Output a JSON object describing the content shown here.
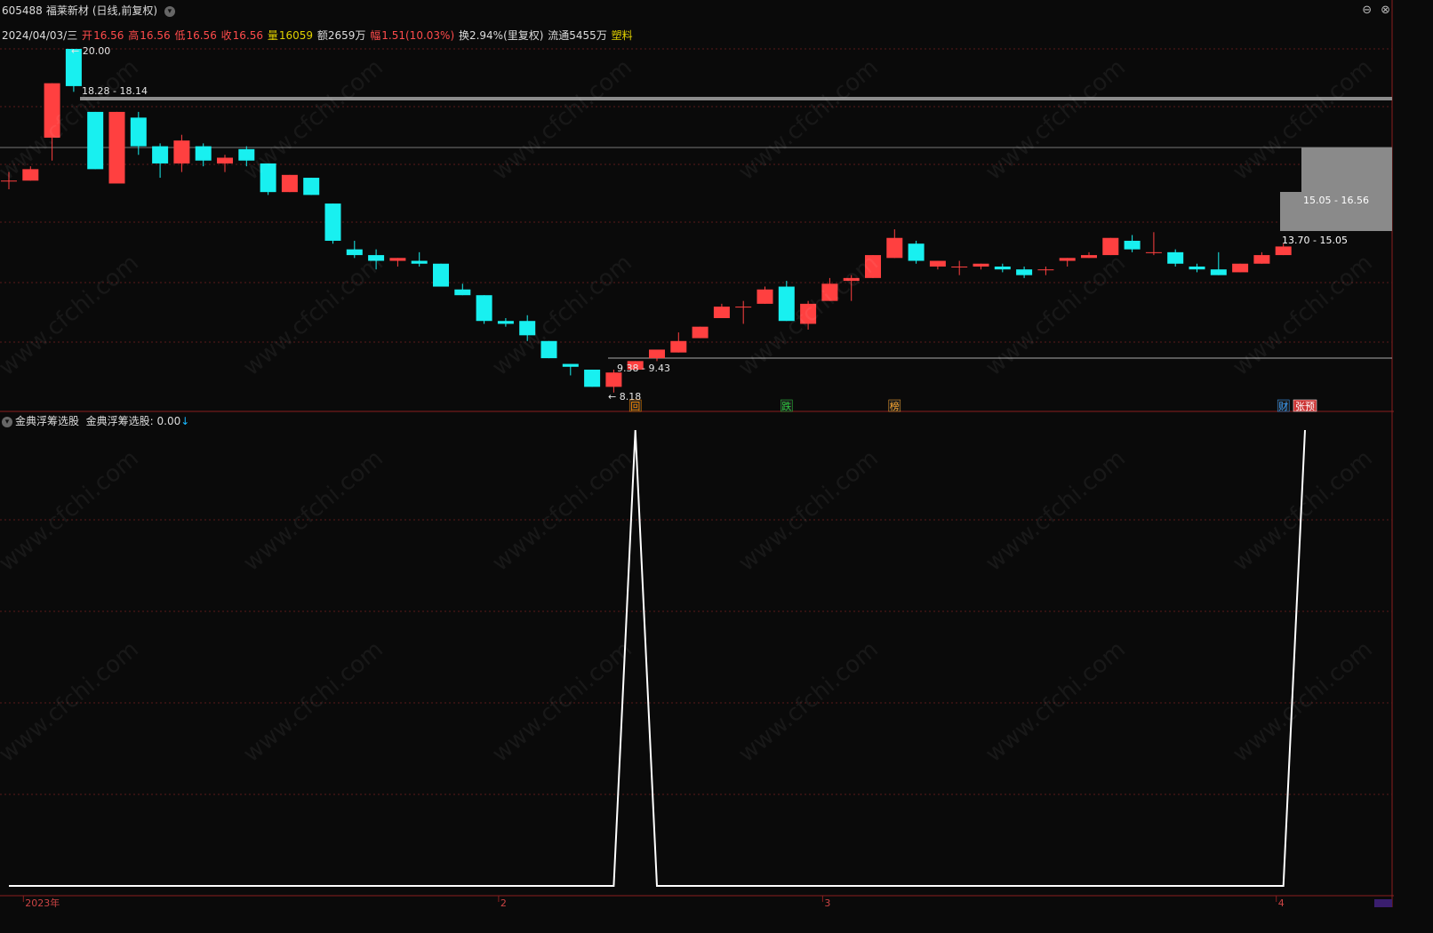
{
  "header": {
    "code": "605488",
    "name": "福莱新材",
    "period": "(日线,前复权)",
    "collapse_icon": "chevron-down-icon",
    "window_controls": [
      "⊖",
      "⊗"
    ]
  },
  "info": {
    "date": "2024/04/03/三",
    "open_label": "开",
    "open": "16.56",
    "high_label": "高",
    "high": "16.56",
    "low_label": "低",
    "low": "16.56",
    "close_label": "收",
    "close": "16.56",
    "vol_label": "量",
    "vol": "16059",
    "amount": "额2659万",
    "change_label": "幅",
    "change": "1.51(10.03%)",
    "turnover": "换2.94%(里复权)",
    "float": "流通5455万",
    "sector": "塑料"
  },
  "indicator": {
    "name": "金典浮筹选股",
    "value_label": "金典浮筹选股: 0.00",
    "arrow": "↓"
  },
  "chart_data": {
    "type": "candlestick",
    "x_labels": [
      {
        "idx": 1,
        "text": "2023年"
      },
      {
        "idx": 23,
        "text": "2"
      },
      {
        "idx": 38,
        "text": "3"
      },
      {
        "idx": 59,
        "text": "4"
      }
    ],
    "annotations": {
      "high": "20.00",
      "low": "8.18",
      "zone_top": "18.28 - 18.14",
      "zone_low": "9.38 - 9.43",
      "zone_right1": "15.05 - 16.56",
      "zone_right2": "13.70 - 15.05"
    },
    "markers": [
      {
        "idx": 29,
        "text": "回",
        "color": "#ff8a00",
        "bg": "#222"
      },
      {
        "idx": 36,
        "text": "跌",
        "color": "#2ecc40",
        "bg": "#1a1a1a"
      },
      {
        "idx": 41,
        "text": "榜",
        "color": "#ffaa33",
        "bg": "#1a1a1a"
      },
      {
        "idx": 59,
        "text": "财",
        "color": "#3fa3ff",
        "bg": "#1a1a1a"
      },
      {
        "idx": 60,
        "text": "张预",
        "color": "#ffffff",
        "bg": "#cc3333"
      }
    ],
    "candles": [
      {
        "o": 15.4,
        "h": 15.7,
        "l": 15.1,
        "c": 15.4
      },
      {
        "o": 15.4,
        "h": 15.9,
        "l": 15.4,
        "c": 15.8
      },
      {
        "o": 16.9,
        "h": 18.8,
        "l": 16.1,
        "c": 18.8
      },
      {
        "o": 20.0,
        "h": 20.0,
        "l": 18.5,
        "c": 18.7
      },
      {
        "o": 17.8,
        "h": 17.8,
        "l": 15.8,
        "c": 15.8
      },
      {
        "o": 15.3,
        "h": 17.8,
        "l": 15.3,
        "c": 17.8
      },
      {
        "o": 17.6,
        "h": 17.8,
        "l": 16.3,
        "c": 16.6
      },
      {
        "o": 16.6,
        "h": 16.7,
        "l": 15.5,
        "c": 16.0
      },
      {
        "o": 16.0,
        "h": 17.0,
        "l": 15.7,
        "c": 16.8
      },
      {
        "o": 16.6,
        "h": 16.7,
        "l": 15.9,
        "c": 16.1
      },
      {
        "o": 16.0,
        "h": 16.3,
        "l": 15.7,
        "c": 16.2
      },
      {
        "o": 16.5,
        "h": 16.6,
        "l": 15.9,
        "c": 16.1
      },
      {
        "o": 16.0,
        "h": 16.0,
        "l": 14.9,
        "c": 15.0
      },
      {
        "o": 15.0,
        "h": 15.6,
        "l": 15.0,
        "c": 15.6
      },
      {
        "o": 15.5,
        "h": 15.5,
        "l": 14.9,
        "c": 14.9
      },
      {
        "o": 14.6,
        "h": 14.6,
        "l": 13.2,
        "c": 13.3
      },
      {
        "o": 13.0,
        "h": 13.3,
        "l": 12.7,
        "c": 12.8
      },
      {
        "o": 12.8,
        "h": 13.0,
        "l": 12.3,
        "c": 12.6
      },
      {
        "o": 12.6,
        "h": 12.7,
        "l": 12.4,
        "c": 12.7
      },
      {
        "o": 12.6,
        "h": 12.9,
        "l": 12.4,
        "c": 12.5
      },
      {
        "o": 12.5,
        "h": 12.5,
        "l": 11.7,
        "c": 11.7
      },
      {
        "o": 11.6,
        "h": 11.8,
        "l": 11.4,
        "c": 11.4
      },
      {
        "o": 11.4,
        "h": 11.4,
        "l": 10.4,
        "c": 10.5
      },
      {
        "o": 10.5,
        "h": 10.6,
        "l": 10.3,
        "c": 10.4
      },
      {
        "o": 10.5,
        "h": 10.7,
        "l": 9.8,
        "c": 10.0
      },
      {
        "o": 9.8,
        "h": 9.8,
        "l": 9.2,
        "c": 9.2
      },
      {
        "o": 9.0,
        "h": 9.0,
        "l": 8.6,
        "c": 8.9
      },
      {
        "o": 8.8,
        "h": 8.8,
        "l": 8.2,
        "c": 8.2
      },
      {
        "o": 8.2,
        "h": 8.8,
        "l": 8.0,
        "c": 8.7
      },
      {
        "o": 8.8,
        "h": 9.1,
        "l": 8.8,
        "c": 9.1
      },
      {
        "o": 9.2,
        "h": 9.5,
        "l": 9.1,
        "c": 9.5
      },
      {
        "o": 9.4,
        "h": 10.1,
        "l": 9.4,
        "c": 9.8
      },
      {
        "o": 9.9,
        "h": 10.3,
        "l": 9.9,
        "c": 10.3
      },
      {
        "o": 10.6,
        "h": 11.1,
        "l": 10.6,
        "c": 11.0
      },
      {
        "o": 11.0,
        "h": 11.2,
        "l": 10.4,
        "c": 11.0
      },
      {
        "o": 11.1,
        "h": 11.7,
        "l": 11.1,
        "c": 11.6
      },
      {
        "o": 11.7,
        "h": 11.9,
        "l": 10.5,
        "c": 10.5
      },
      {
        "o": 10.4,
        "h": 11.2,
        "l": 10.2,
        "c": 11.1
      },
      {
        "o": 11.2,
        "h": 12.0,
        "l": 11.2,
        "c": 11.8
      },
      {
        "o": 11.9,
        "h": 12.1,
        "l": 11.2,
        "c": 12.0
      },
      {
        "o": 12.0,
        "h": 12.8,
        "l": 12.0,
        "c": 12.8
      },
      {
        "o": 12.7,
        "h": 13.7,
        "l": 12.7,
        "c": 13.4
      },
      {
        "o": 13.2,
        "h": 13.3,
        "l": 12.5,
        "c": 12.6
      },
      {
        "o": 12.4,
        "h": 12.6,
        "l": 12.3,
        "c": 12.6
      },
      {
        "o": 12.4,
        "h": 12.6,
        "l": 12.1,
        "c": 12.4
      },
      {
        "o": 12.4,
        "h": 12.5,
        "l": 12.3,
        "c": 12.5
      },
      {
        "o": 12.4,
        "h": 12.5,
        "l": 12.2,
        "c": 12.3
      },
      {
        "o": 12.3,
        "h": 12.4,
        "l": 12.0,
        "c": 12.1
      },
      {
        "o": 12.3,
        "h": 12.4,
        "l": 12.1,
        "c": 12.3
      },
      {
        "o": 12.6,
        "h": 12.7,
        "l": 12.4,
        "c": 12.7
      },
      {
        "o": 12.7,
        "h": 12.9,
        "l": 12.7,
        "c": 12.8
      },
      {
        "o": 12.8,
        "h": 13.4,
        "l": 12.8,
        "c": 13.4
      },
      {
        "o": 13.3,
        "h": 13.5,
        "l": 12.9,
        "c": 13.0
      },
      {
        "o": 12.9,
        "h": 13.6,
        "l": 12.8,
        "c": 12.9
      },
      {
        "o": 12.9,
        "h": 13.0,
        "l": 12.4,
        "c": 12.5
      },
      {
        "o": 12.4,
        "h": 12.5,
        "l": 12.2,
        "c": 12.3
      },
      {
        "o": 12.3,
        "h": 12.9,
        "l": 12.1,
        "c": 12.1
      },
      {
        "o": 12.2,
        "h": 12.5,
        "l": 12.2,
        "c": 12.5
      },
      {
        "o": 12.5,
        "h": 12.9,
        "l": 12.5,
        "c": 12.8
      },
      {
        "o": 12.8,
        "h": 13.2,
        "l": 12.8,
        "c": 13.1
      }
    ],
    "indicator_values": [
      0,
      0,
      0,
      0,
      0,
      0,
      0,
      0,
      0,
      0,
      0,
      0,
      0,
      0,
      0,
      0,
      0,
      0,
      0,
      0,
      0,
      0,
      0,
      0,
      0,
      0,
      0,
      0,
      0,
      1,
      0,
      0,
      0,
      0,
      0,
      0,
      0,
      0,
      0,
      0,
      0,
      0,
      0,
      0,
      0,
      0,
      0,
      0,
      0,
      0,
      0,
      0,
      0,
      0,
      0,
      0,
      0,
      0,
      0,
      0,
      1
    ],
    "colors": {
      "up": "#ff4040",
      "down": "#18f0f0",
      "grid": "#5a1a1a",
      "line": "#ffffff"
    }
  }
}
